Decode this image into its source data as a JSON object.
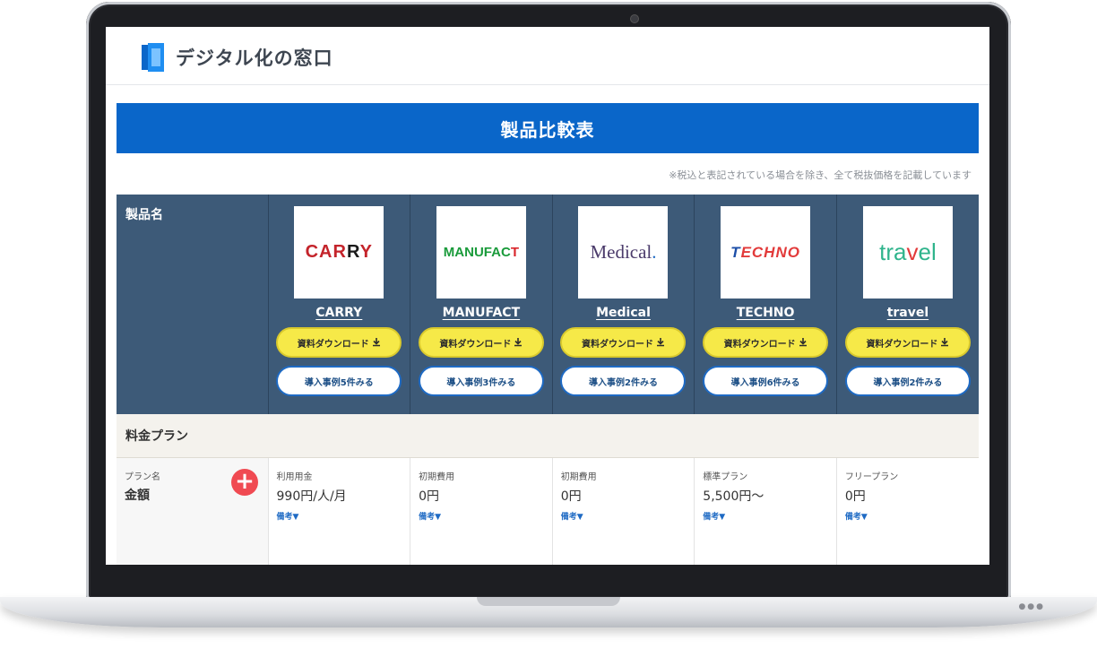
{
  "header": {
    "site_name": "デジタル化の窓口"
  },
  "page": {
    "title": "製品比較表",
    "tax_note": "※税込と表記されている場合を除き、全て税抜価格を記載しています"
  },
  "table": {
    "product_label": "製品名",
    "section_label": "料金プラン",
    "plan_small_label": "プラン名",
    "plan_title_label": "金額",
    "plus_symbol": "+",
    "download_label": "資料ダウンロード",
    "download_icon": "download-icon",
    "products": [
      {
        "name": "CARRY",
        "logo_text": "CARRY",
        "case_label": "導入事例5件みる",
        "plan_type": "利用用金",
        "plan_price": "990円/人/月",
        "note": "備考▼"
      },
      {
        "name": "MANUFACT",
        "logo_text": "MANUFACT",
        "case_label": "導入事例3件みる",
        "plan_type": "初期費用",
        "plan_price": "0円",
        "note": "備考▼"
      },
      {
        "name": "Medical",
        "logo_text": "Medical.",
        "case_label": "導入事例2件みる",
        "plan_type": "初期費用",
        "plan_price": "0円",
        "note": "備考▼"
      },
      {
        "name": "TECHNO",
        "logo_text": "TECHNO",
        "case_label": "導入事例6件みる",
        "plan_type": "標準プラン",
        "plan_price": "5,500円〜",
        "note": "備考▼"
      },
      {
        "name": "travel",
        "logo_text": "travel",
        "case_label": "導入事例2件みる",
        "plan_type": "フリープラン",
        "plan_price": "0円",
        "note": "備考▼"
      }
    ]
  },
  "colors": {
    "banner": "#0a66c9",
    "table_header": "#3d5a78",
    "download_button": "#f6e948",
    "case_button_border": "#1e6ac4",
    "plus_button": "#f04a52"
  }
}
